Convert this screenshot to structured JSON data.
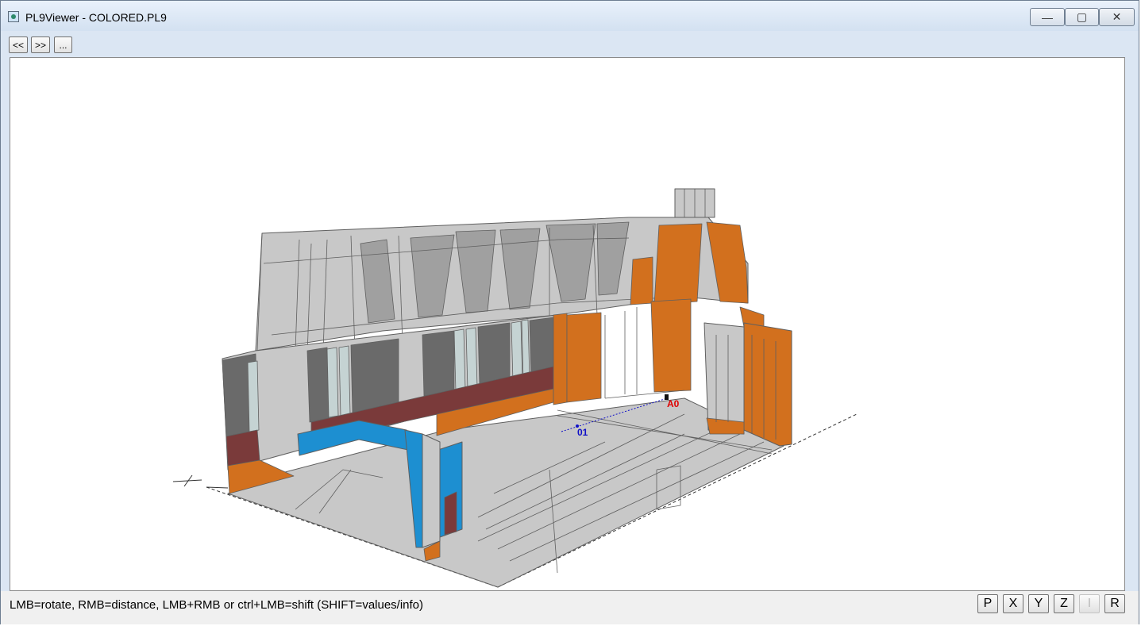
{
  "window": {
    "title": "PL9Viewer - COLORED.PL9",
    "controls": {
      "minimize": "—",
      "maximize": "▢",
      "close": "✕"
    }
  },
  "toolbar": {
    "prev_label": "<<",
    "next_label": ">>",
    "more_label": "..."
  },
  "viewport": {
    "point_labels": {
      "a0": "A0",
      "p01": "01"
    },
    "colors": {
      "light_gray": "#c8c8c8",
      "mid_gray": "#a0a0a0",
      "dark_gray": "#6a6a6a",
      "pale": "#c5d3d3",
      "orange": "#d2701e",
      "maroon": "#7a3a3a",
      "blue": "#1d8fd1",
      "edge": "#5f5f5f",
      "label_red": "#e00000",
      "label_blue": "#1010c8"
    }
  },
  "status": {
    "hint": "LMB=rotate, RMB=distance, LMB+RMB or ctrl+LMB=shift (SHIFT=values/info)"
  },
  "view_buttons": [
    {
      "label": "P",
      "enabled": true
    },
    {
      "label": "X",
      "enabled": true
    },
    {
      "label": "Y",
      "enabled": true
    },
    {
      "label": "Z",
      "enabled": true
    },
    {
      "label": "I",
      "enabled": false
    },
    {
      "label": "R",
      "enabled": true
    }
  ]
}
